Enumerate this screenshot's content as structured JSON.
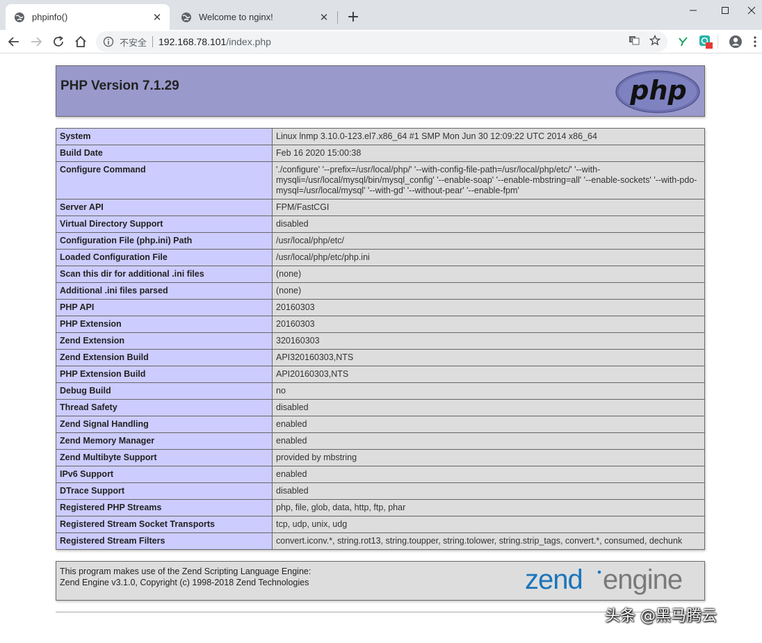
{
  "browser": {
    "tabs": [
      {
        "title": "phpinfo()",
        "active": true
      },
      {
        "title": "Welcome to nginx!",
        "active": false
      }
    ],
    "security_label": "不安全",
    "url_host": "192.168.78.101",
    "url_path": "/index.php"
  },
  "page": {
    "title": "PHP Version 7.1.29",
    "rows": [
      {
        "label": "System",
        "value": "Linux lnmp 3.10.0-123.el7.x86_64 #1 SMP Mon Jun 30 12:09:22 UTC 2014 x86_64"
      },
      {
        "label": "Build Date",
        "value": "Feb 16 2020 15:00:38"
      },
      {
        "label": "Configure Command",
        "value": "'./configure' '--prefix=/usr/local/php/' '--with-config-file-path=/usr/local/php/etc/' '--with-mysqli=/usr/local/mysql/bin/mysql_config' '--enable-soap' '--enable-mbstring=all' '--enable-sockets' '--with-pdo-mysql=/usr/local/mysql' '--with-gd' '--without-pear' '--enable-fpm'"
      },
      {
        "label": "Server API",
        "value": "FPM/FastCGI"
      },
      {
        "label": "Virtual Directory Support",
        "value": "disabled"
      },
      {
        "label": "Configuration File (php.ini) Path",
        "value": "/usr/local/php/etc/"
      },
      {
        "label": "Loaded Configuration File",
        "value": "/usr/local/php/etc/php.ini"
      },
      {
        "label": "Scan this dir for additional .ini files",
        "value": "(none)"
      },
      {
        "label": "Additional .ini files parsed",
        "value": "(none)"
      },
      {
        "label": "PHP API",
        "value": "20160303"
      },
      {
        "label": "PHP Extension",
        "value": "20160303"
      },
      {
        "label": "Zend Extension",
        "value": "320160303"
      },
      {
        "label": "Zend Extension Build",
        "value": "API320160303,NTS"
      },
      {
        "label": "PHP Extension Build",
        "value": "API20160303,NTS"
      },
      {
        "label": "Debug Build",
        "value": "no"
      },
      {
        "label": "Thread Safety",
        "value": "disabled"
      },
      {
        "label": "Zend Signal Handling",
        "value": "enabled"
      },
      {
        "label": "Zend Memory Manager",
        "value": "enabled"
      },
      {
        "label": "Zend Multibyte Support",
        "value": "provided by mbstring"
      },
      {
        "label": "IPv6 Support",
        "value": "enabled"
      },
      {
        "label": "DTrace Support",
        "value": "disabled"
      },
      {
        "label": "Registered PHP Streams",
        "value": "php, file, glob, data, http, ftp, phar"
      },
      {
        "label": "Registered Stream Socket Transports",
        "value": "tcp, udp, unix, udg"
      },
      {
        "label": "Registered Stream Filters",
        "value": "convert.iconv.*, string.rot13, string.toupper, string.tolower, string.strip_tags, convert.*, consumed, dechunk"
      }
    ],
    "zend_line1": "This program makes use of the Zend Scripting Language Engine:",
    "zend_line2": "Zend Engine v3.1.0, Copyright (c) 1998-2018 Zend Technologies",
    "php_logo_text": "php",
    "zend_logo_text": "zend",
    "zend_logo_text2": "engine"
  },
  "watermark": "头条 @黑马腾云",
  "colors": {
    "header_bg": "#9999cc",
    "label_bg": "#ccccff",
    "value_bg": "#dddddd",
    "zend_blue": "#1b75bb",
    "zend_gray": "#7a7a7a"
  }
}
